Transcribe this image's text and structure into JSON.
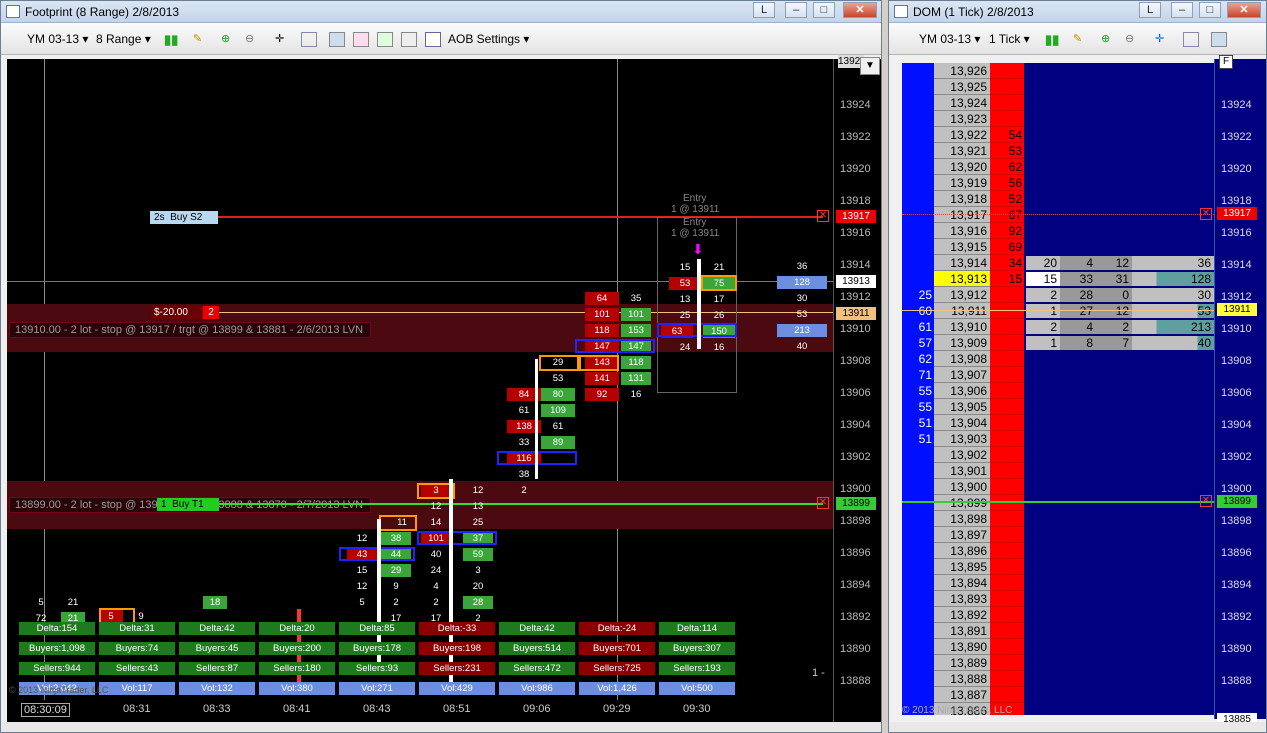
{
  "footprint": {
    "title": "Footprint (8 Range)  2/8/2013",
    "toolbar": {
      "instrument": "YM 03-13",
      "interval": "8 Range",
      "aob": "AOB Settings"
    },
    "price_labels": [
      "13924",
      "13922",
      "13920",
      "13918",
      "13916",
      "13914",
      "13912",
      "13910",
      "13908",
      "13906",
      "13904",
      "13902",
      "13900",
      "13898",
      "13896",
      "13894",
      "13892",
      "13890",
      "13888"
    ],
    "top_price_badge": "1392",
    "time_labels": [
      "08:30:09",
      "08:31",
      "08:33",
      "08:41",
      "08:43",
      "08:51",
      "09:06",
      "09:29",
      "09:30"
    ],
    "buy_s2": {
      "tag": "2s",
      "text": "Buy S2",
      "price": "13917"
    },
    "buy_t1": {
      "tag": "1",
      "text": "Buy T1",
      "price": "13899"
    },
    "pnl": {
      "value": "$-20.00",
      "qty": "2"
    },
    "line_13911": "13911",
    "line_13913": "13913",
    "note_top": "13910.00 - 2 lot - stop @ 13917 / trgt @ 13899 & 13881 - 2/6/2013 LVN",
    "note_bottom": "13899.00 - 2 lot - stop @ 13917 / trgt @ 13888 & 13870 - 2/7/2013 LVN",
    "entry_label": "Entry",
    "entry_detail": "1 @ 13911",
    "entry_label2": "Entry",
    "entry_detail2": "1 @ 13911",
    "copyright": "© 2013 NinjaTrader, LLC",
    "page_marker": "1 -",
    "deltas": [
      "Delta:154",
      "Delta:31",
      "Delta:42",
      "Delta:20",
      "Delta:85",
      "Delta:-33",
      "Delta:42",
      "Delta:-24",
      "Delta:114"
    ],
    "buyers": [
      "Buyers:1,098",
      "Buyers:74",
      "Buyers:45",
      "Buyers:200",
      "Buyers:178",
      "Buyers:198",
      "Buyers:514",
      "Buyers:701",
      "Buyers:307"
    ],
    "sellers": [
      "Sellers:944",
      "Sellers:43",
      "Sellers:87",
      "Sellers:180",
      "Sellers:93",
      "Sellers:231",
      "Sellers:472",
      "Sellers:725",
      "Sellers:193"
    ],
    "vols": [
      "Vol:2,042",
      "Vol:117",
      "Vol:132",
      "Vol:380",
      "Vol:271",
      "Vol:429",
      "Vol:986",
      "Vol:1,426",
      "Vol:500"
    ]
  },
  "dom": {
    "title": "DOM (1 Tick)  2/8/2013",
    "toolbar": {
      "instrument": "YM 03-13",
      "interval": "1 Tick"
    },
    "rows": [
      {
        "price": "13,926",
        "ask": "",
        "bid": ""
      },
      {
        "price": "13,925",
        "ask": "",
        "bid": ""
      },
      {
        "price": "13,924",
        "ask": "",
        "bid": ""
      },
      {
        "price": "13,923",
        "ask": "",
        "bid": ""
      },
      {
        "price": "13,922",
        "ask": "54",
        "bid": ""
      },
      {
        "price": "13,921",
        "ask": "53",
        "bid": ""
      },
      {
        "price": "13,920",
        "ask": "62",
        "bid": ""
      },
      {
        "price": "13,919",
        "ask": "56",
        "bid": ""
      },
      {
        "price": "13,918",
        "ask": "52",
        "bid": ""
      },
      {
        "price": "13,917",
        "ask": "67",
        "bid": ""
      },
      {
        "price": "13,916",
        "ask": "92",
        "bid": ""
      },
      {
        "price": "13,915",
        "ask": "69",
        "bid": ""
      },
      {
        "price": "13,914",
        "ask": "34",
        "bid": ""
      },
      {
        "price": "13,913",
        "ask": "15",
        "bid": ""
      },
      {
        "price": "13,912",
        "ask": "",
        "bid": "25"
      },
      {
        "price": "13,911",
        "ask": "",
        "bid": "60"
      },
      {
        "price": "13,910",
        "ask": "",
        "bid": "61"
      },
      {
        "price": "13,909",
        "ask": "",
        "bid": "57"
      },
      {
        "price": "13,908",
        "ask": "",
        "bid": "62"
      },
      {
        "price": "13,907",
        "ask": "",
        "bid": "71"
      },
      {
        "price": "13,906",
        "ask": "",
        "bid": "55"
      },
      {
        "price": "13,905",
        "ask": "",
        "bid": "55"
      },
      {
        "price": "13,904",
        "ask": "",
        "bid": "51"
      },
      {
        "price": "13,903",
        "ask": "",
        "bid": "51"
      },
      {
        "price": "13,902",
        "ask": "",
        "bid": ""
      },
      {
        "price": "13,901",
        "ask": "",
        "bid": ""
      },
      {
        "price": "13,900",
        "ask": "",
        "bid": ""
      },
      {
        "price": "13,899",
        "ask": "",
        "bid": ""
      },
      {
        "price": "13,898",
        "ask": "",
        "bid": ""
      },
      {
        "price": "13,897",
        "ask": "",
        "bid": ""
      },
      {
        "price": "13,896",
        "ask": "",
        "bid": ""
      },
      {
        "price": "13,895",
        "ask": "",
        "bid": ""
      },
      {
        "price": "13,894",
        "ask": "",
        "bid": ""
      },
      {
        "price": "13,893",
        "ask": "",
        "bid": ""
      },
      {
        "price": "13,892",
        "ask": "",
        "bid": ""
      },
      {
        "price": "13,891",
        "ask": "",
        "bid": ""
      },
      {
        "price": "13,890",
        "ask": "",
        "bid": ""
      },
      {
        "price": "13,889",
        "ask": "",
        "bid": ""
      },
      {
        "price": "13,888",
        "ask": "",
        "bid": ""
      },
      {
        "price": "13,887",
        "ask": "",
        "bid": ""
      },
      {
        "price": "13,886",
        "ask": "",
        "bid": ""
      }
    ],
    "vol_rows": [
      {
        "a": "20",
        "b": "4",
        "c": "12",
        "d": "36"
      },
      {
        "a": "15",
        "b": "33",
        "c": "31",
        "d": "128"
      },
      {
        "a": "2",
        "b": "28",
        "c": "0",
        "d": "30"
      },
      {
        "a": "1",
        "b": "27",
        "c": "12",
        "d": "53"
      },
      {
        "a": "2",
        "b": "4",
        "c": "2",
        "d": "213"
      },
      {
        "a": "1",
        "b": "8",
        "c": "7",
        "d": "40"
      }
    ],
    "price_labels": [
      "13924",
      "13922",
      "13920",
      "13918",
      "13916",
      "13914",
      "13912",
      "13910",
      "13908",
      "13906",
      "13904",
      "13902",
      "13900",
      "13898",
      "13896",
      "13894",
      "13892",
      "13890",
      "13888"
    ],
    "badge_13917": "13917",
    "badge_13911": "13911",
    "badge_13899": "13899",
    "badge_bottom": "13885",
    "copyright": "© 2013 NinjaTrader, LLC",
    "f_button": "F"
  }
}
